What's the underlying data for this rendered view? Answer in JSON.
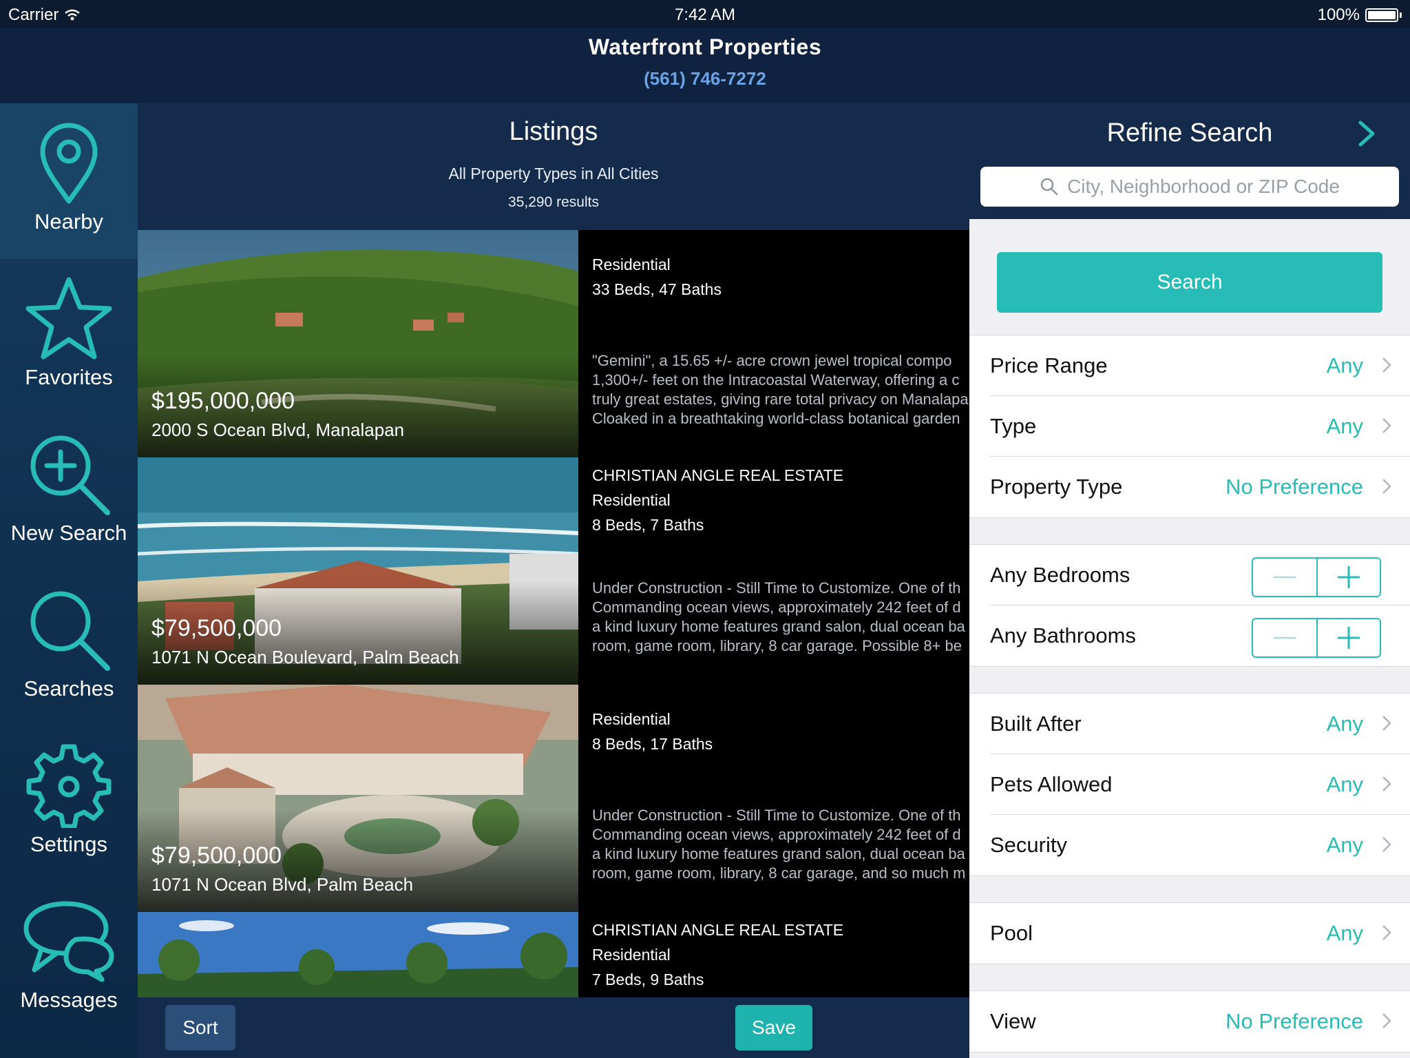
{
  "status_bar": {
    "carrier": "Carrier",
    "time": "7:42 AM",
    "battery": "100%"
  },
  "header": {
    "title": "Waterfront Properties",
    "phone": "(561) 746-7272"
  },
  "sidebar": {
    "items": [
      {
        "label": "Nearby",
        "icon": "location-pin-icon"
      },
      {
        "label": "Favorites",
        "icon": "star-icon"
      },
      {
        "label": "New Search",
        "icon": "zoom-in-icon"
      },
      {
        "label": "Searches",
        "icon": "search-icon"
      },
      {
        "label": "Settings",
        "icon": "gear-icon"
      },
      {
        "label": "Messages",
        "icon": "chat-bubbles-icon"
      }
    ]
  },
  "listings": {
    "title": "Listings",
    "subtitle": "All Property Types in All Cities",
    "results": "35,290 results",
    "items": [
      {
        "price": "$195,000,000",
        "address": "2000 S Ocean Blvd, Manalapan",
        "agency": "",
        "type": "Residential",
        "beds_baths": "33 Beds, 47 Baths",
        "desc": [
          "\"Gemini\", a 15.65 +/- acre crown jewel tropical compo",
          "1,300+/- feet on the Intracoastal Waterway, offering a c",
          "truly great estates, giving rare total privacy on Manalapa",
          "Cloaked in a breathtaking world-class botanical garden"
        ]
      },
      {
        "price": "$79,500,000",
        "address": "1071 N Ocean Boulevard, Palm Beach",
        "agency": "CHRISTIAN ANGLE REAL ESTATE",
        "type": "Residential",
        "beds_baths": "8 Beds, 7 Baths",
        "desc": [
          "Under Construction - Still Time to Customize. One of th",
          "Commanding ocean views, approximately 242 feet of d",
          "a kind luxury home features grand salon, dual ocean ba",
          "room, game room, library, 8 car garage. Possible 8+ be"
        ]
      },
      {
        "price": "$79,500,000",
        "address": "1071 N Ocean Blvd, Palm Beach",
        "agency": "",
        "type": "Residential",
        "beds_baths": "8 Beds, 17 Baths",
        "desc": [
          "Under Construction - Still Time to Customize. One of th",
          "Commanding ocean views, approximately 242 feet of d",
          "a kind luxury home features grand salon, dual ocean ba",
          "room, game room, library, 8 car garage, and so much m"
        ]
      },
      {
        "price": "",
        "address": "",
        "agency": "CHRISTIAN ANGLE REAL ESTATE",
        "type": "Residential",
        "beds_baths": "7 Beds, 9 Baths",
        "desc": []
      }
    ]
  },
  "bottom_bar": {
    "sort_label": "Sort",
    "save_label": "Save"
  },
  "refine": {
    "title": "Refine Search",
    "search_placeholder": "City, Neighborhood or ZIP Code",
    "search_button": "Search",
    "price_range": {
      "label": "Price Range",
      "value": "Any"
    },
    "type": {
      "label": "Type",
      "value": "Any"
    },
    "property_type": {
      "label": "Property Type",
      "value": "No Preference"
    },
    "bedrooms": {
      "label": "Any Bedrooms"
    },
    "bathrooms": {
      "label": "Any Bathrooms"
    },
    "built_after": {
      "label": "Built After",
      "value": "Any"
    },
    "pets_allowed": {
      "label": "Pets Allowed",
      "value": "Any"
    },
    "security": {
      "label": "Security",
      "value": "Any"
    },
    "pool": {
      "label": "Pool",
      "value": "Any"
    },
    "view": {
      "label": "View",
      "value": "No Preference"
    }
  },
  "colors": {
    "accent": "#27bdb6",
    "nav_bg": "#142b4b",
    "phone": "#6aa3e6"
  }
}
